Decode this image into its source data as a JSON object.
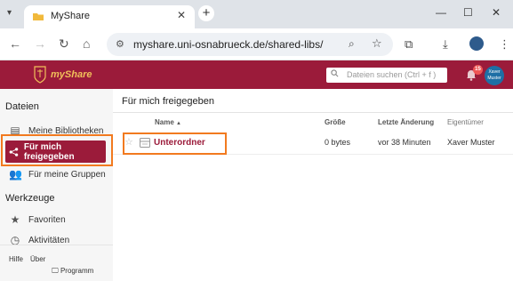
{
  "browser": {
    "tab_title": "MyShare",
    "tab_close": "✕",
    "new_tab": "+",
    "url": "myshare.uni-osnabrueck.de/shared-libs/",
    "window_controls": [
      "—",
      "☐",
      "✕"
    ]
  },
  "app": {
    "logo_text": "myShare",
    "search_placeholder": "Dateien suchen (Ctrl + f )",
    "notification_count": "15",
    "avatar_text": "Xaver Muster"
  },
  "sidebar": {
    "files_heading": "Dateien",
    "items": [
      {
        "label": "Meine Bibliotheken",
        "icon": "library-icon"
      },
      {
        "label": "Für mich freigegeben",
        "icon": "share-icon",
        "active": true
      },
      {
        "label": "Für meine Gruppen",
        "icon": "group-icon"
      }
    ],
    "tools_heading": "Werkzeuge",
    "tools": [
      {
        "label": "Favoriten",
        "icon": "star-icon"
      },
      {
        "label": "Aktivitäten",
        "icon": "history-icon"
      }
    ],
    "footer": {
      "help": "Hilfe",
      "about": "Über",
      "client": "Programm"
    }
  },
  "main": {
    "title": "Für mich freigegeben",
    "columns": {
      "name": "Name",
      "sort_indicator": "▲",
      "size": "Größe",
      "modified": "Letzte Änderung",
      "owner": "Eigentümer"
    },
    "rows": [
      {
        "name": "Unterordner",
        "size": "0 bytes",
        "modified": "vor 38 Minuten",
        "owner": "Xaver Muster"
      }
    ]
  },
  "colors": {
    "brand": "#9b1b3a",
    "highlight": "#f27a1f"
  }
}
